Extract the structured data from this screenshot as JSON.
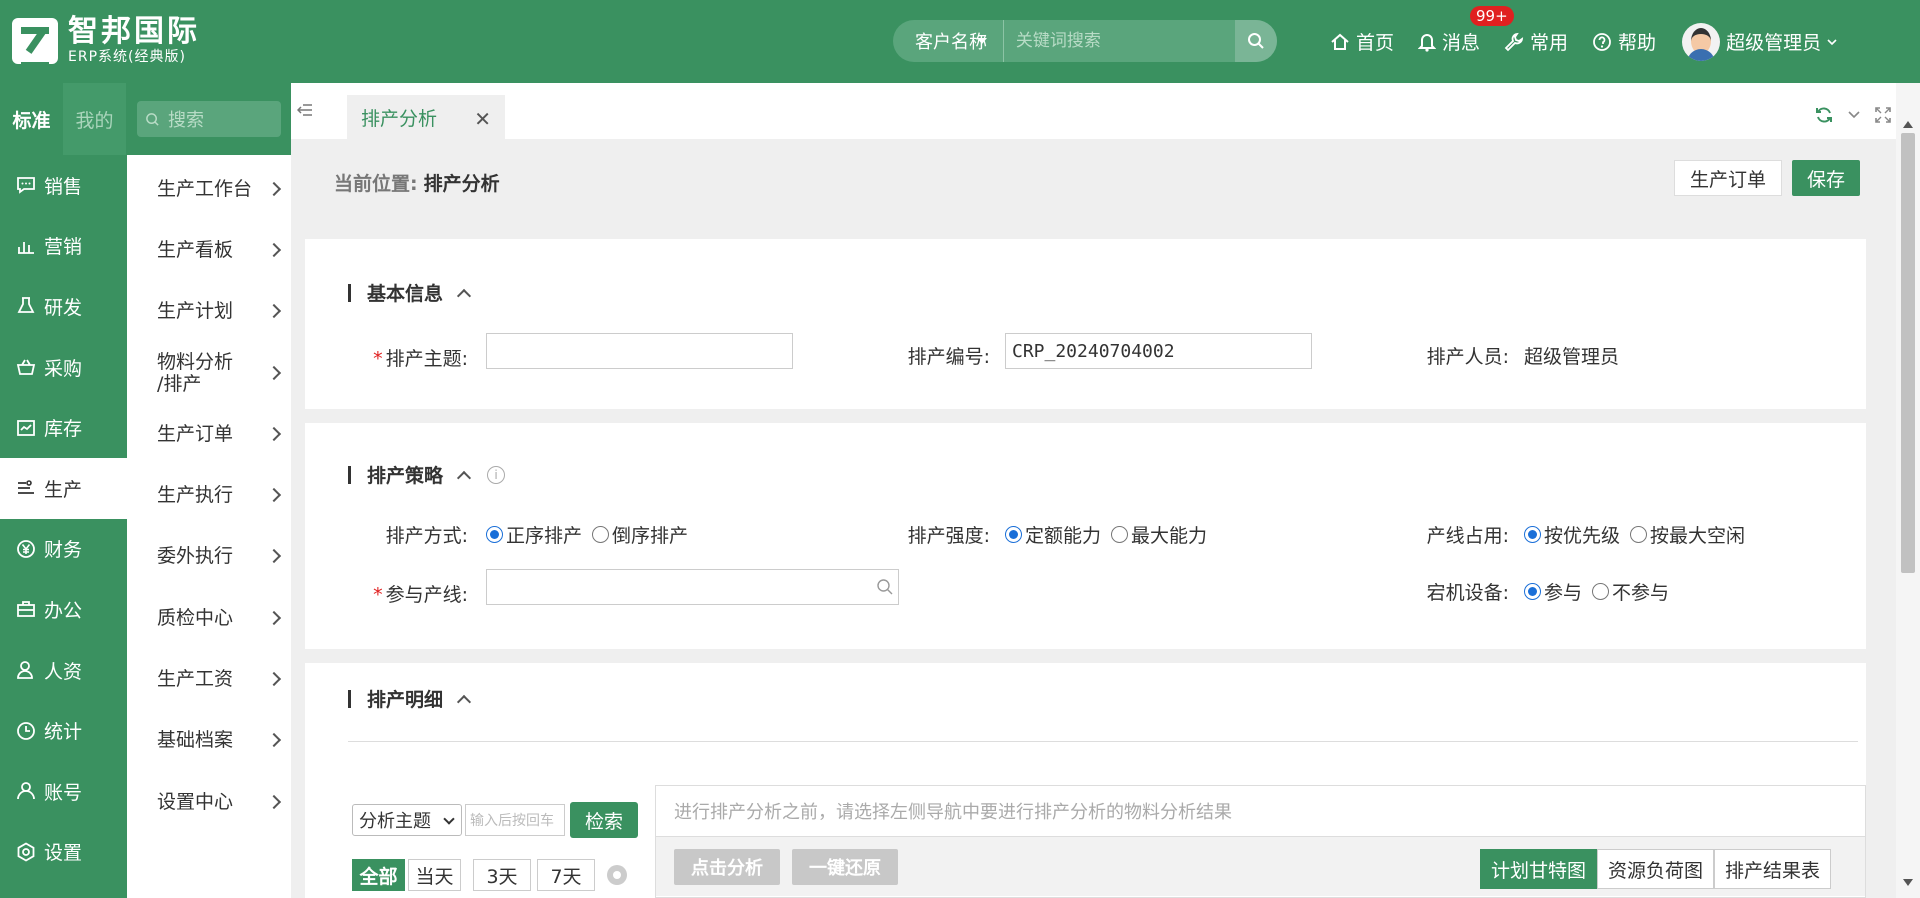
{
  "brand": {
    "title": "智邦国际",
    "subtitle": "ERP系统(经典版)"
  },
  "topbar": {
    "search_scope": "客户名称",
    "search_placeholder": "关键词搜索",
    "nav": [
      {
        "label": "首页",
        "icon": "home-icon"
      },
      {
        "label": "消息",
        "icon": "bell-icon",
        "badge": "99+"
      },
      {
        "label": "常用",
        "icon": "wrench-icon"
      },
      {
        "label": "帮助",
        "icon": "help-icon"
      }
    ],
    "user": "超级管理员"
  },
  "rail": {
    "tabs": [
      "标准",
      "我的"
    ],
    "items": [
      {
        "label": "销售",
        "icon": "chat-icon"
      },
      {
        "label": "营销",
        "icon": "chart-icon"
      },
      {
        "label": "研发",
        "icon": "flask-icon"
      },
      {
        "label": "采购",
        "icon": "basket-icon"
      },
      {
        "label": "库存",
        "icon": "inventory-icon"
      },
      {
        "label": "生产",
        "icon": "production-icon",
        "active": true
      },
      {
        "label": "财务",
        "icon": "yen-icon"
      },
      {
        "label": "办公",
        "icon": "briefcase-icon"
      },
      {
        "label": "人资",
        "icon": "person-icon"
      },
      {
        "label": "统计",
        "icon": "clock-icon"
      },
      {
        "label": "账号",
        "icon": "user-icon"
      },
      {
        "label": "设置",
        "icon": "settings-icon"
      }
    ]
  },
  "submenu": {
    "search_placeholder": "搜索",
    "items": [
      "生产工作台",
      "生产看板",
      "生产计划",
      "物料分析/排产",
      "生产订单",
      "生产执行",
      "委外执行",
      "质检中心",
      "生产工资",
      "基础档案",
      "设置中心"
    ]
  },
  "page_tab": "排产分析",
  "breadcrumb": {
    "label": "当前位置:",
    "current": "排产分析"
  },
  "actions": {
    "order": "生产订单",
    "save": "保存"
  },
  "basic_info": {
    "title": "基本信息",
    "subject_label": "排产主题:",
    "subject_value": "",
    "code_label": "排产编号:",
    "code_value": "CRP_20240704002",
    "person_label": "排产人员:",
    "person_value": "超级管理员"
  },
  "strategy": {
    "title": "排产策略",
    "method_label": "排产方式:",
    "method_options": [
      "正序排产",
      "倒序排产"
    ],
    "intensity_label": "排产强度:",
    "intensity_options": [
      "定额能力",
      "最大能力"
    ],
    "line_use_label": "产线占用:",
    "line_use_options": [
      "按优先级",
      "按最大空闲"
    ],
    "lines_label": "参与产线:",
    "lines_value": "",
    "downtime_label": "宕机设备:",
    "downtime_options": [
      "参与",
      "不参与"
    ]
  },
  "detail": {
    "title": "排产明细",
    "filter_select": "分析主题",
    "filter_placeholder": "输入后按回车",
    "search_button": "检索",
    "days": [
      "全部",
      "当天",
      "3天",
      "7天"
    ],
    "tip": "进行排产分析之前，请选择左侧导航中要进行排产分析的物料分析结果",
    "analyze_button": "点击分析",
    "restore_button": "一键还原",
    "views": [
      "计划甘特图",
      "资源负荷图",
      "排产结果表"
    ]
  },
  "colors": {
    "brand": "#3a9160",
    "accent": "#1a6fd8",
    "badge": "#e02020"
  }
}
